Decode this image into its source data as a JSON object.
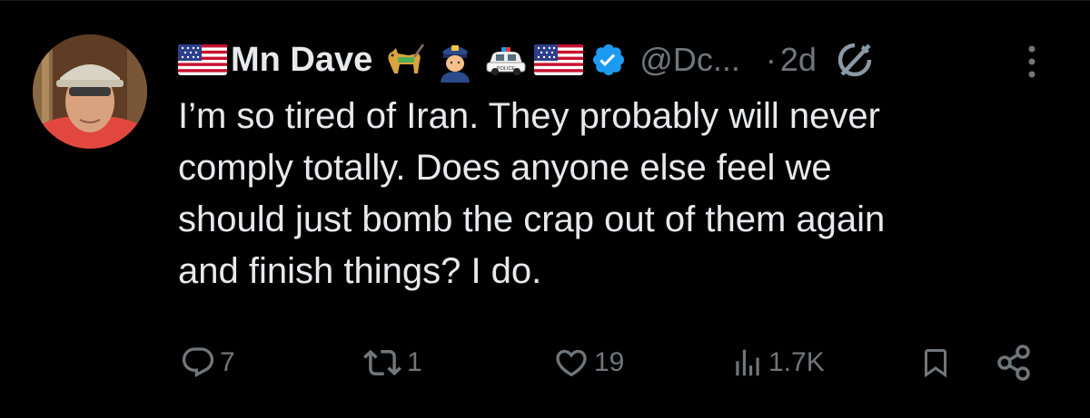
{
  "tweet": {
    "author": {
      "display_name": "Mn Dave",
      "handle": "@Dc...",
      "verified": true,
      "name_emojis": [
        "us-flag",
        "guide-dog",
        "police-officer",
        "police-car",
        "us-flag"
      ]
    },
    "timestamp": "2d",
    "separator": "·",
    "text_lines": [
      "I’m so tired of Iran. They probably will never",
      "comply totally. Does anyone else feel we",
      "should just bomb the crap out of them again",
      "and finish things?  I do."
    ],
    "police_car_label": "POLICE",
    "stats": {
      "replies": "7",
      "reposts": "1",
      "likes": "19",
      "views": "1.7K"
    },
    "icons": {
      "grok": "grok-icon",
      "more": "more-icon",
      "reply": "reply-icon",
      "repost": "repost-icon",
      "like": "heart-icon",
      "views": "views-icon",
      "bookmark": "bookmark-icon",
      "share": "share-icon"
    },
    "colors": {
      "background": "#000000",
      "text": "#e7e9ea",
      "muted": "#71767b",
      "verified_blue": "#1d9bf0"
    }
  }
}
